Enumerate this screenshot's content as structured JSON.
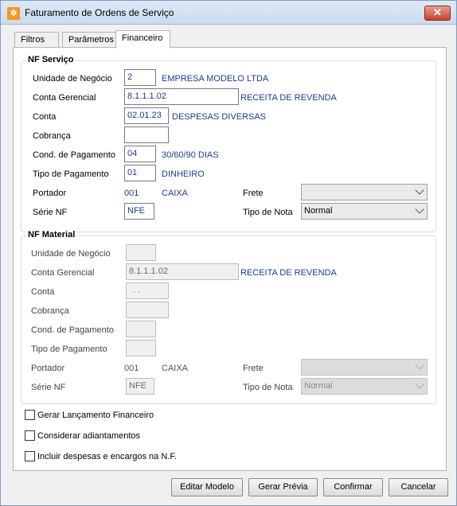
{
  "window": {
    "title": "Faturamento de Ordens de Serviço",
    "close_glyph": "✕"
  },
  "tabs": [
    {
      "label": "Filtros"
    },
    {
      "label": "Parâmetros"
    },
    {
      "label": "Financeiro"
    }
  ],
  "nf_servico": {
    "title": "NF Serviço",
    "unidade": {
      "label": "Unidade de Negócio",
      "value": "2",
      "desc": "EMPRESA MODELO LTDA"
    },
    "conta_gerencial": {
      "label": "Conta Gerencial",
      "value": "8.1.1.1.02",
      "desc": "RECEITA DE REVENDA"
    },
    "conta": {
      "label": "Conta",
      "value": "02.01.23",
      "desc": "DESPESAS DIVERSAS"
    },
    "cobranca": {
      "label": "Cobrança",
      "value": ""
    },
    "cond_pagamento": {
      "label": "Cond. de Pagamento",
      "value": "04",
      "desc": "30/60/90 DIAS"
    },
    "tipo_pagamento": {
      "label": "Tipo de Pagamento",
      "value": "01",
      "desc": "DINHEIRO"
    },
    "portador": {
      "label": "Portador",
      "code": "001",
      "desc": "CAIXA"
    },
    "frete": {
      "label": "Frete",
      "value": ""
    },
    "serie_nf": {
      "label": "Série NF",
      "value": "NFE"
    },
    "tipo_nota": {
      "label": "Tipo de Nota",
      "value": "Normal"
    }
  },
  "nf_material": {
    "title": "NF Material",
    "unidade": {
      "label": "Unidade de Negócio",
      "value": ""
    },
    "conta_gerencial": {
      "label": "Conta Gerencial",
      "value": "8.1.1.1.02",
      "desc": "RECEITA DE REVENDA"
    },
    "conta": {
      "label": "Conta",
      "value": ". ."
    },
    "cobranca": {
      "label": "Cobrança",
      "value": ""
    },
    "cond_pagamento": {
      "label": "Cond. de Pagamento",
      "value": ""
    },
    "tipo_pagamento": {
      "label": "Tipo de Pagamento",
      "value": ""
    },
    "portador": {
      "label": "Portador",
      "code": "001",
      "desc": "CAIXA"
    },
    "frete": {
      "label": "Frete",
      "value": ""
    },
    "serie_nf": {
      "label": "Série NF",
      "value": "NFE"
    },
    "tipo_nota": {
      "label": "Tipo de Nota",
      "value": "Normal"
    }
  },
  "options": [
    {
      "label": "Gerar Lançamento Financeiro"
    },
    {
      "label": "Considerar adiantamentos"
    },
    {
      "label": "Incluir despesas e encargos na N.F."
    }
  ],
  "buttons": {
    "editar_modelo": "Editar Modelo",
    "gerar_previa": "Gerar Prévia",
    "confirmar": "Confirmar",
    "cancelar": "Cancelar"
  }
}
